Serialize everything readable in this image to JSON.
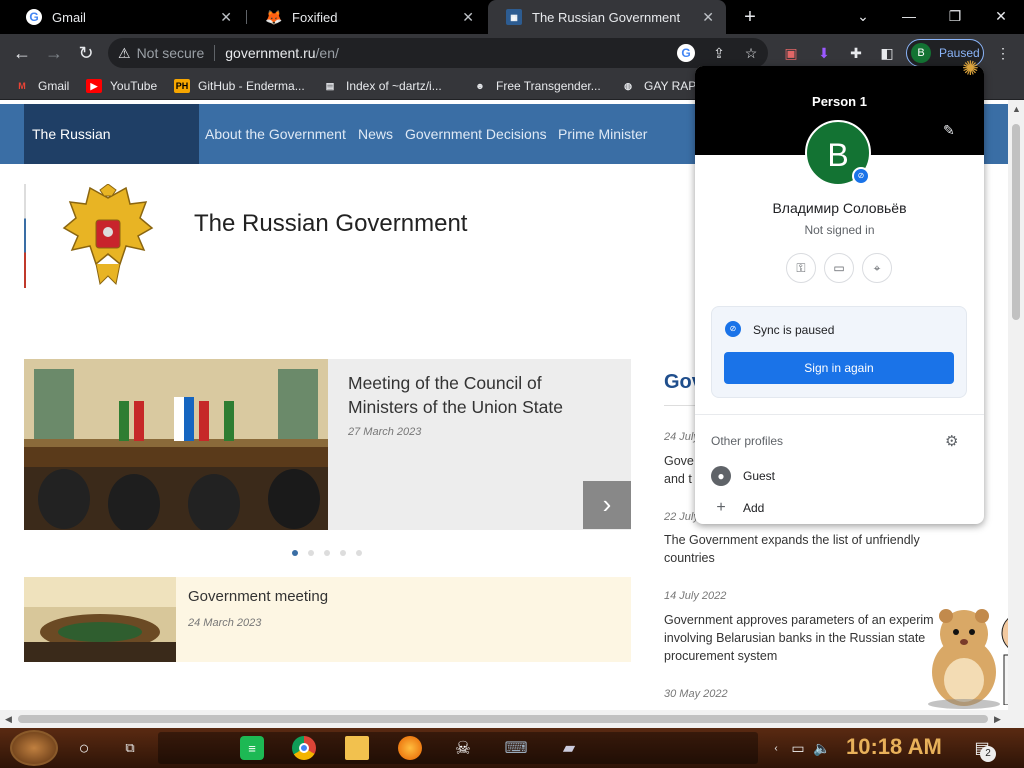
{
  "browser": {
    "tabs": [
      {
        "title": "Gmail",
        "icon": "gmail-g-icon"
      },
      {
        "title": "Foxified",
        "icon": "fox-icon"
      },
      {
        "title": "The Russian Government",
        "icon": "government-icon"
      }
    ],
    "active_tab": 2,
    "url": {
      "security_label": "Not secure",
      "host": "government.ru",
      "path": "/en/"
    },
    "profile_chip": {
      "avatar_letter": "B",
      "label": "Paused"
    },
    "bookmarks": [
      {
        "label": "Gmail"
      },
      {
        "label": "YouTube"
      },
      {
        "label": "GitHub - Enderma..."
      },
      {
        "label": "Index of ~dartz/i..."
      },
      {
        "label": "Free Transgender..."
      },
      {
        "label": "GAY RAP"
      }
    ],
    "colors": {
      "accent": "#8ab4f8",
      "tab_active": "#35363a",
      "avatar_green": "#137333"
    }
  },
  "site": {
    "nav": [
      {
        "label": "The Russian Government"
      },
      {
        "label": "About the Government"
      },
      {
        "label": "News"
      },
      {
        "label": "Government Decisions"
      },
      {
        "label": "Prime Minister"
      }
    ],
    "title": "The Russian Government",
    "slider": {
      "title": "Meeting of the Council of Ministers of the Union State",
      "date": "27 March 2023",
      "dots": 5,
      "active_dot": 0
    },
    "news": {
      "title": "Government meeting",
      "date": "24 March 2023"
    },
    "right_column": {
      "heading": "Gov",
      "items": [
        {
          "date": "24 July",
          "text": "Gove and t"
        },
        {
          "date": "22 July",
          "text": "The Government expands the list of unfriendly countries"
        },
        {
          "date": "14 July 2022",
          "text": "Government approves parameters of an experim involving Belarusian banks in the Russian state procurement system"
        },
        {
          "date": "30 May 2022",
          "text": ""
        }
      ]
    },
    "colors": {
      "nav_bg": "#3a6ea5",
      "nav_active": "#1f3f66",
      "heading": "#1f4e8c"
    }
  },
  "profile_popup": {
    "header_name": "Person 1",
    "avatar_letter": "B",
    "user_name": "Владимир Соловьёв",
    "status": "Not signed in",
    "quick_icons": [
      "key-icon",
      "card-icon",
      "location-icon"
    ],
    "sync_text": "Sync is paused",
    "sign_in_button": "Sign in again",
    "other_profiles_label": "Other profiles",
    "profiles": [
      {
        "label": "Guest",
        "icon": "person-icon"
      },
      {
        "label": "Add",
        "icon": "plus-icon"
      }
    ]
  },
  "taskbar": {
    "clock": "10:18 AM",
    "notification_count": "2",
    "apps": [
      "start-orb",
      "cortana-circle",
      "task-view",
      "spotify",
      "chrome",
      "file-explorer",
      "firefox",
      "skull-app",
      "keyboard-app",
      "notepad-app"
    ]
  }
}
